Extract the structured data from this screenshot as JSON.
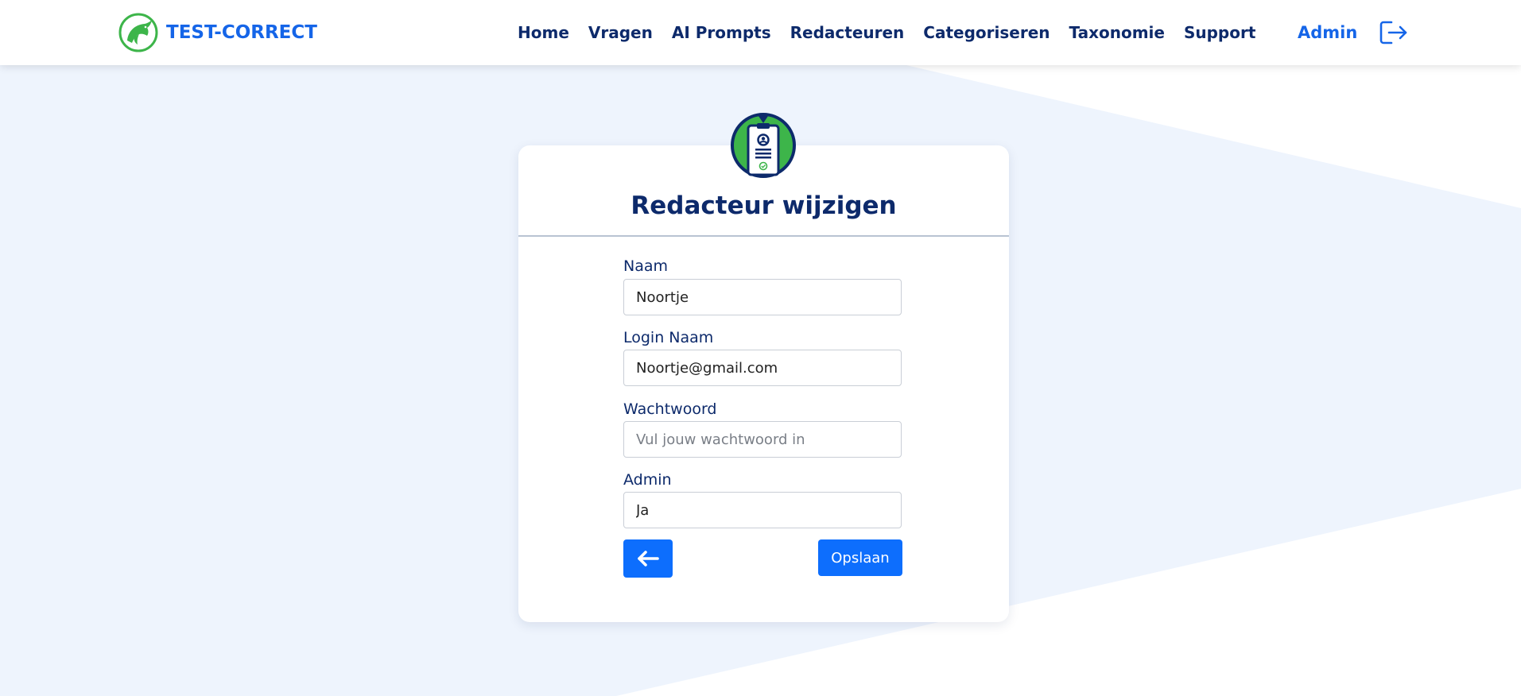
{
  "brand": {
    "name": "TEST-CORRECT",
    "logo_icon": "dolphin-logo-icon"
  },
  "nav": {
    "links": [
      "Home",
      "Vragen",
      "AI Prompts",
      "Redacteuren",
      "Categoriseren",
      "Taxonomie",
      "Support"
    ],
    "user_label": "Admin",
    "logout_icon": "logout-icon"
  },
  "card": {
    "icon": "id-badge-icon",
    "title": "Redacteur wijzigen"
  },
  "form": {
    "name": {
      "label": "Naam",
      "value": "Noortje"
    },
    "login": {
      "label": "Login Naam",
      "value": "Noortje@gmail.com"
    },
    "password": {
      "label": "Wachtwoord",
      "value": "",
      "placeholder": "Vul jouw wachtwoord in"
    },
    "admin": {
      "label": "Admin",
      "value": "Ja"
    }
  },
  "buttons": {
    "back_icon": "arrow-left-icon",
    "save_label": "Opslaan"
  },
  "colors": {
    "primary": "#0d6efd",
    "brand_blue": "#1565e8",
    "navy": "#0d2a6b",
    "brand_green": "#3db54a",
    "background": "#eef4fd"
  }
}
